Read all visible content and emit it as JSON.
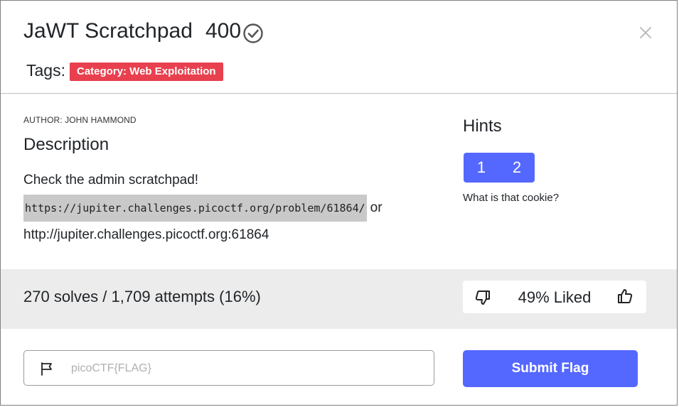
{
  "header": {
    "title": "JaWT Scratchpad",
    "points": "400",
    "tags_label": "Tags:",
    "tag": "Category: Web Exploitation"
  },
  "body": {
    "author": "AUTHOR: JOHN HAMMOND",
    "description_heading": "Description",
    "description_text": "Check the admin scratchpad!",
    "link_primary": "https://jupiter.challenges.picoctf.org/problem/61864/",
    "link_separator": "or",
    "link_secondary": "http://jupiter.challenges.picoctf.org:61864"
  },
  "hints": {
    "heading": "Hints",
    "buttons": [
      "1",
      "2"
    ],
    "text": "What is that cookie?"
  },
  "stats": {
    "solves_text": "270 solves / 1,709 attempts (16%)",
    "liked_text": "49% Liked"
  },
  "flag_form": {
    "placeholder": "picoCTF{FLAG}",
    "submit_label": "Submit Flag"
  },
  "colors": {
    "accent": "#5468ff",
    "tag": "#e8404e",
    "stats_bg": "#ececec"
  },
  "icons": {
    "solved": "check-circle-icon",
    "close": "close-icon",
    "dislike": "thumbs-down-icon",
    "like": "thumbs-up-icon",
    "flag": "flag-icon"
  }
}
